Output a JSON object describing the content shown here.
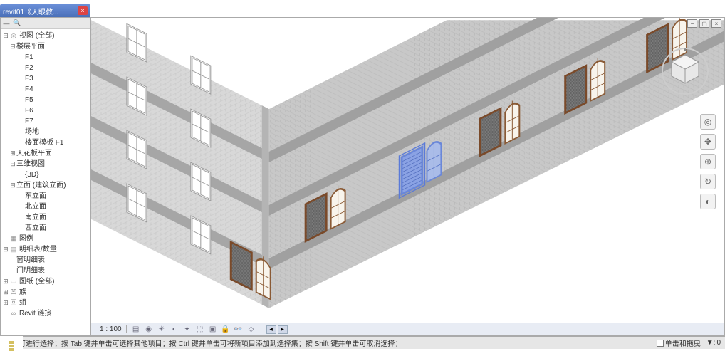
{
  "title": "revit01《天眼教...",
  "browser": {
    "root": "视图 (全部)",
    "floorPlans": {
      "label": "楼层平面",
      "items": [
        "F1",
        "F2",
        "F3",
        "F4",
        "F5",
        "F6",
        "F7",
        "场地",
        "楼面模板 F1"
      ]
    },
    "ceilingPlans": "天花板平面",
    "threeD": {
      "label": "三维视图",
      "item": "{3D}"
    },
    "elevations": {
      "label": "立面 (建筑立面)",
      "items": [
        "东立面",
        "北立面",
        "南立面",
        "西立面"
      ]
    },
    "legends": "图例",
    "schedules": {
      "label": "明细表/数量",
      "items": [
        "窗明细表",
        "门明细表"
      ]
    },
    "sheets": "图纸 (全部)",
    "families": "族",
    "groups": "组",
    "links": "Revit 链接"
  },
  "viewbar": {
    "scale": "1 : 100"
  },
  "status": {
    "tip": "单击可进行选择；按 Tab 键并单击可选择其他项目；按 Ctrl 键并单击可将新项目添加到选择集；按 Shift 键并单击可取消选择；",
    "press": "单击和拖曳",
    "filter": "0"
  },
  "model": {
    "ground": "#e8e8e8",
    "brick_light": "#d8d8d8",
    "brick_dark": "#c0c0c0",
    "band": "#a8a8a8",
    "win_frame": "#aaa",
    "win_glass": "#f8f8f8",
    "door_frame_wood": "#8a5a35",
    "door_frame_brown": "#7a4a2a",
    "shutter": "#555",
    "shutter_line": "#888",
    "sel_blue": "#5a7ad8"
  }
}
